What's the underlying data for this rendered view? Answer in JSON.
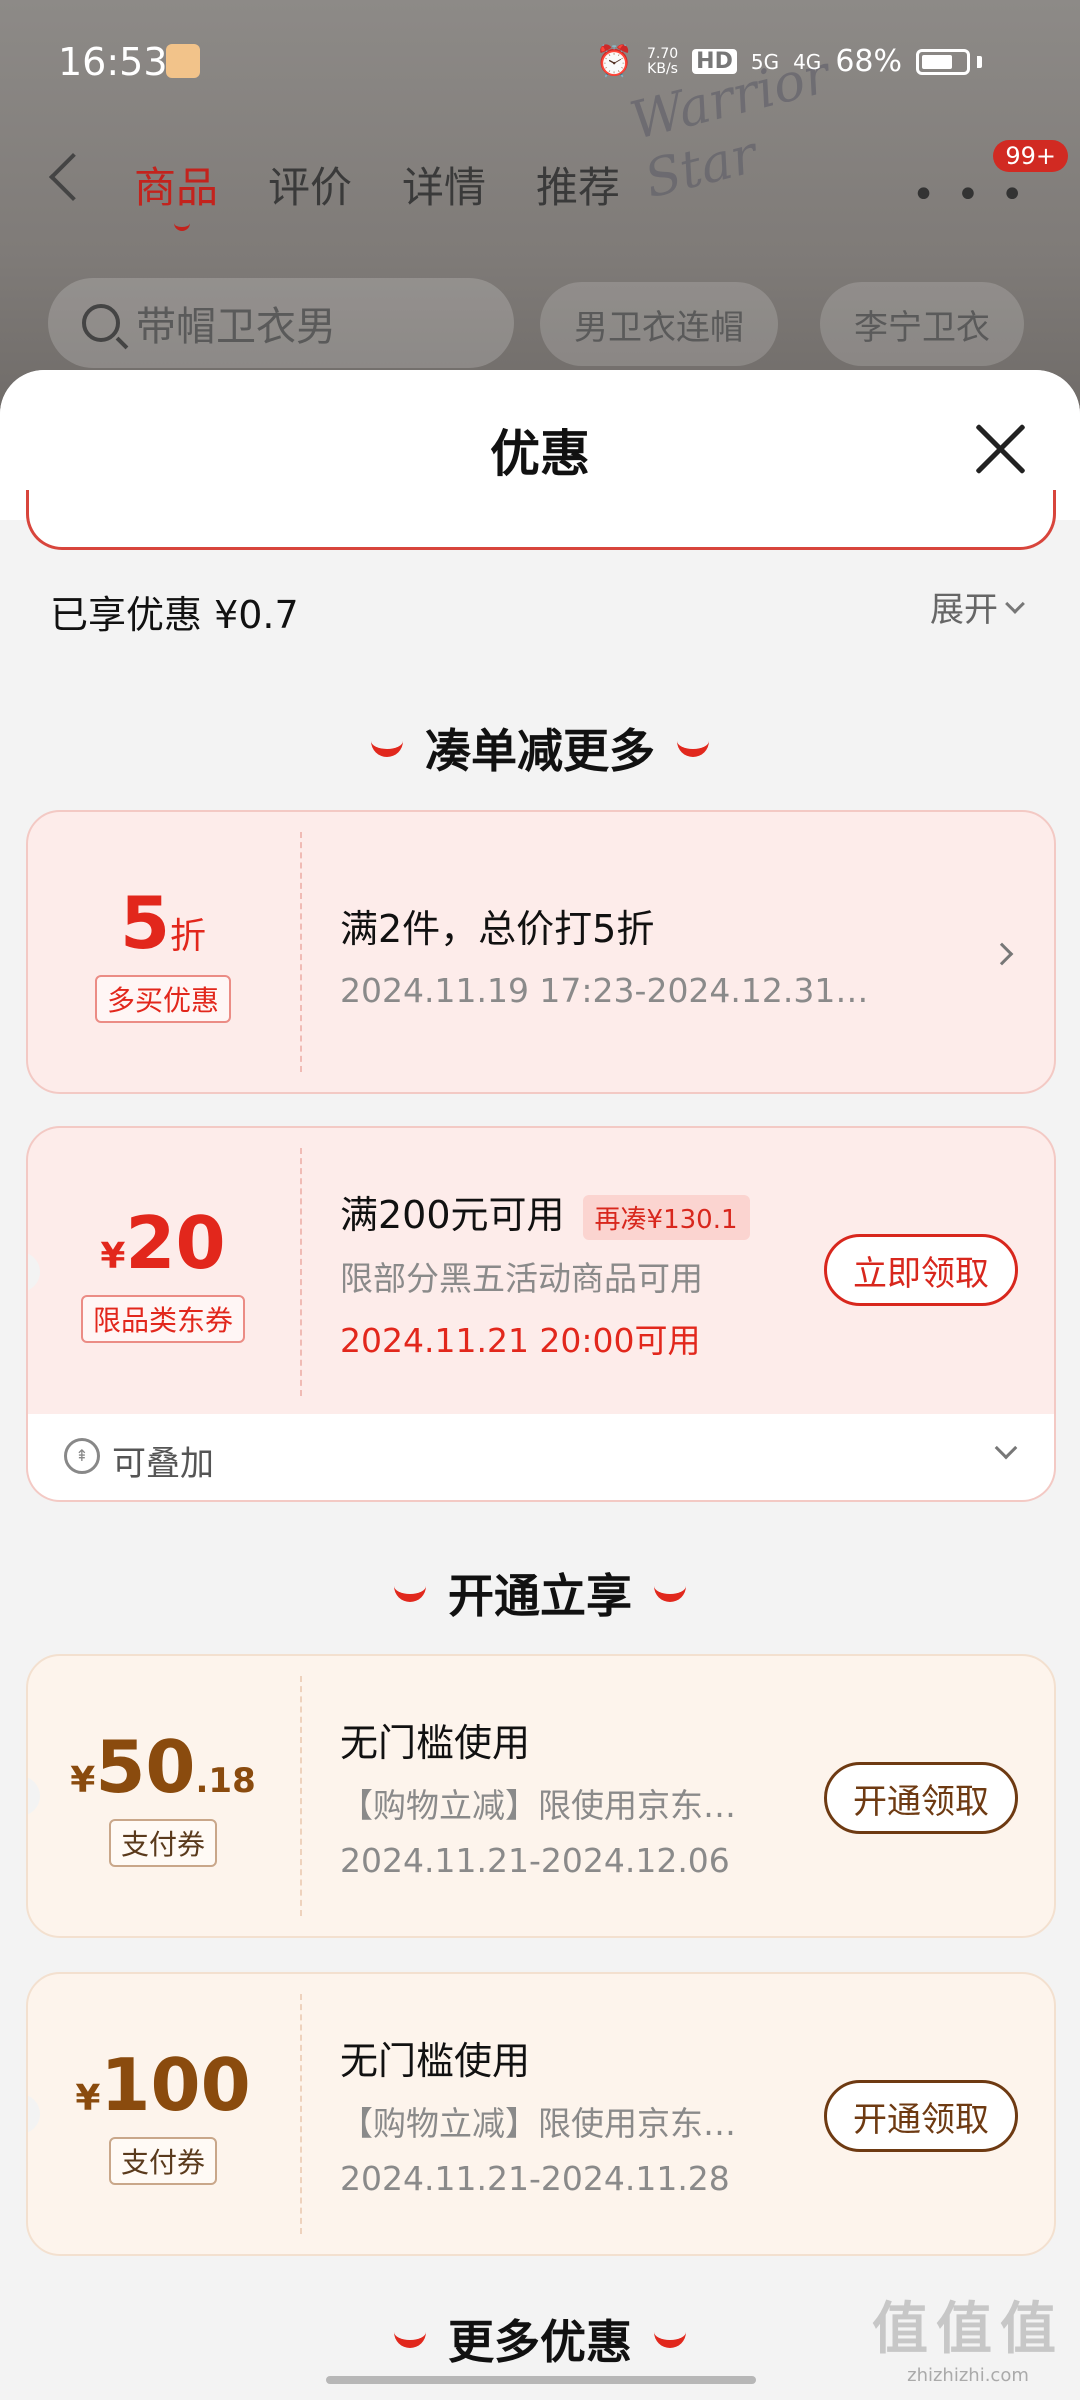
{
  "status_bar": {
    "time": "16:53",
    "net_speed_value": "7.70",
    "net_speed_unit": "KB/s",
    "hd": "HD",
    "sig1": "5G",
    "sig2": "4G",
    "battery": "68%"
  },
  "nav": {
    "tabs": [
      "商品",
      "评价",
      "详情",
      "推荐"
    ],
    "active_tab": 0,
    "more": "• • •",
    "badge": "99+"
  },
  "search": {
    "placeholder": "带帽卫衣男",
    "chips": [
      "男卫衣连帽",
      "李宁卫衣"
    ]
  },
  "background_graphic_text": "Warrior Star",
  "sheet": {
    "title": "优惠",
    "saved": "已享优惠 ¥0.7",
    "expand_label": "展开"
  },
  "sections": {
    "s1": "凑单减更多",
    "s2": "开通立享",
    "s3": "更多优惠"
  },
  "cards": [
    {
      "amount_num": "5",
      "amount_unit": "折",
      "tag": "多买优惠",
      "title": "满2件，总价打5折",
      "date": "2024.11.19 17:23-2024.12.31…"
    },
    {
      "currency": "¥",
      "amount_num": "20",
      "tag": "限品类东券",
      "title": "满200元可用",
      "hint": "再凑¥130.1",
      "sub": "限部分黑五活动商品可用",
      "date": "2024.11.21 20:00可用",
      "button": "立即领取",
      "stack_label": "可叠加"
    },
    {
      "currency": "¥",
      "amount_num": "50",
      "amount_dec": ".18",
      "tag": "支付券",
      "title": "无门槛使用",
      "sub": "【购物立减】限使用京东…",
      "date": "2024.11.21-2024.12.06",
      "button": "开通领取"
    },
    {
      "currency": "¥",
      "amount_num": "100",
      "tag": "支付券",
      "title": "无门槛使用",
      "sub": "【购物立减】限使用京东…",
      "date": "2024.11.21-2024.11.28",
      "button": "开通领取"
    }
  ],
  "watermark": {
    "big": "值值值",
    "small": "zhizhizhi.com"
  }
}
